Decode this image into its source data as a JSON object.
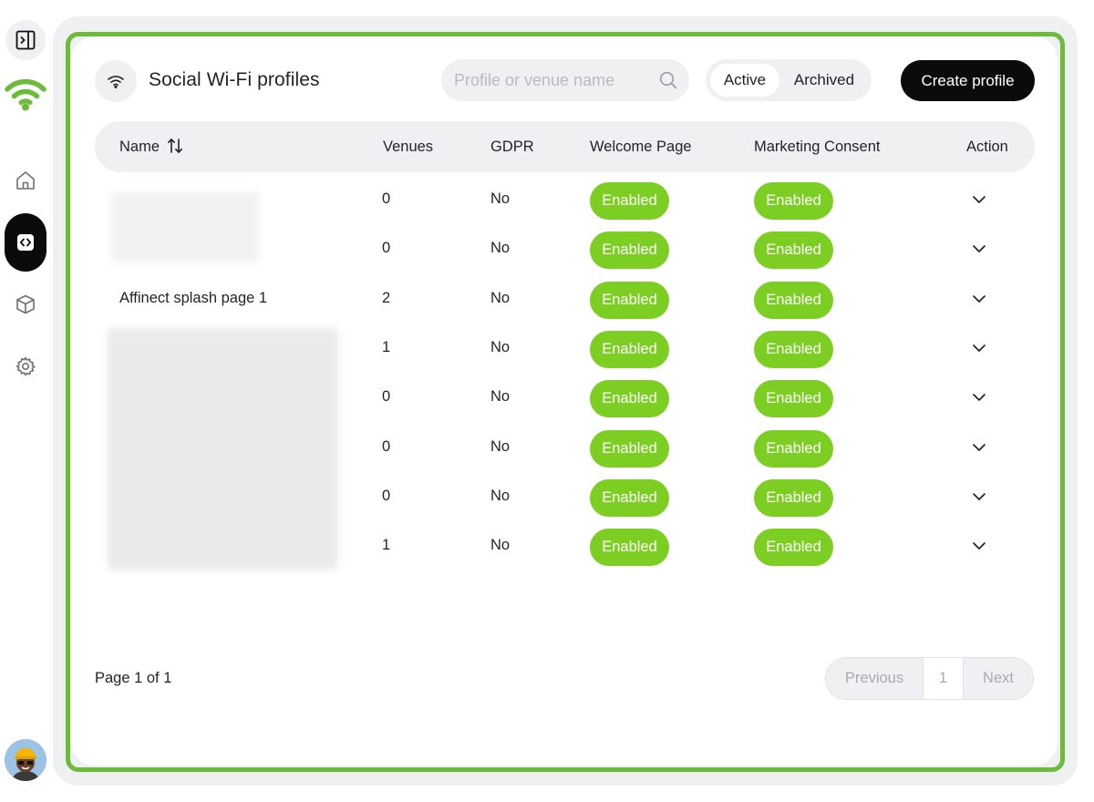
{
  "header": {
    "title": "Social Wi-Fi profiles",
    "search_placeholder": "Profile or venue name",
    "tab_active": "Active",
    "tab_archived": "Archived",
    "create_label": "Create profile"
  },
  "table": {
    "columns": [
      "Name",
      "Venues",
      "GDPR",
      "Welcome Page",
      "Marketing Consent",
      "Action"
    ],
    "rows": [
      {
        "name": "",
        "venues": "0",
        "gdpr": "No",
        "welcome": "Enabled",
        "marketing": "Enabled"
      },
      {
        "name": "",
        "venues": "0",
        "gdpr": "No",
        "welcome": "Enabled",
        "marketing": "Enabled"
      },
      {
        "name": "Affinect splash page 1",
        "venues": "2",
        "gdpr": "No",
        "welcome": "Enabled",
        "marketing": "Enabled"
      },
      {
        "name": "",
        "venues": "1",
        "gdpr": "No",
        "welcome": "Enabled",
        "marketing": "Enabled"
      },
      {
        "name": "",
        "venues": "0",
        "gdpr": "No",
        "welcome": "Enabled",
        "marketing": "Enabled"
      },
      {
        "name": "",
        "venues": "0",
        "gdpr": "No",
        "welcome": "Enabled",
        "marketing": "Enabled"
      },
      {
        "name": "",
        "venues": "0",
        "gdpr": "No",
        "welcome": "Enabled",
        "marketing": "Enabled"
      },
      {
        "name": "",
        "venues": "1",
        "gdpr": "No",
        "welcome": "Enabled",
        "marketing": "Enabled"
      }
    ]
  },
  "pagination": {
    "info": "Page 1 of 1",
    "previous": "Previous",
    "current": "1",
    "next": "Next"
  },
  "colors": {
    "accent_green": "#7ccf22",
    "frame_green": "#6dbb3a",
    "brand_black": "#0b0b0b"
  },
  "icons": [
    "sidebar-toggle-icon",
    "wifi-logo",
    "home-icon",
    "code-icon",
    "cube-icon",
    "gear-icon",
    "wifi-icon",
    "search-icon",
    "sort-icon",
    "chevron-down-icon"
  ]
}
